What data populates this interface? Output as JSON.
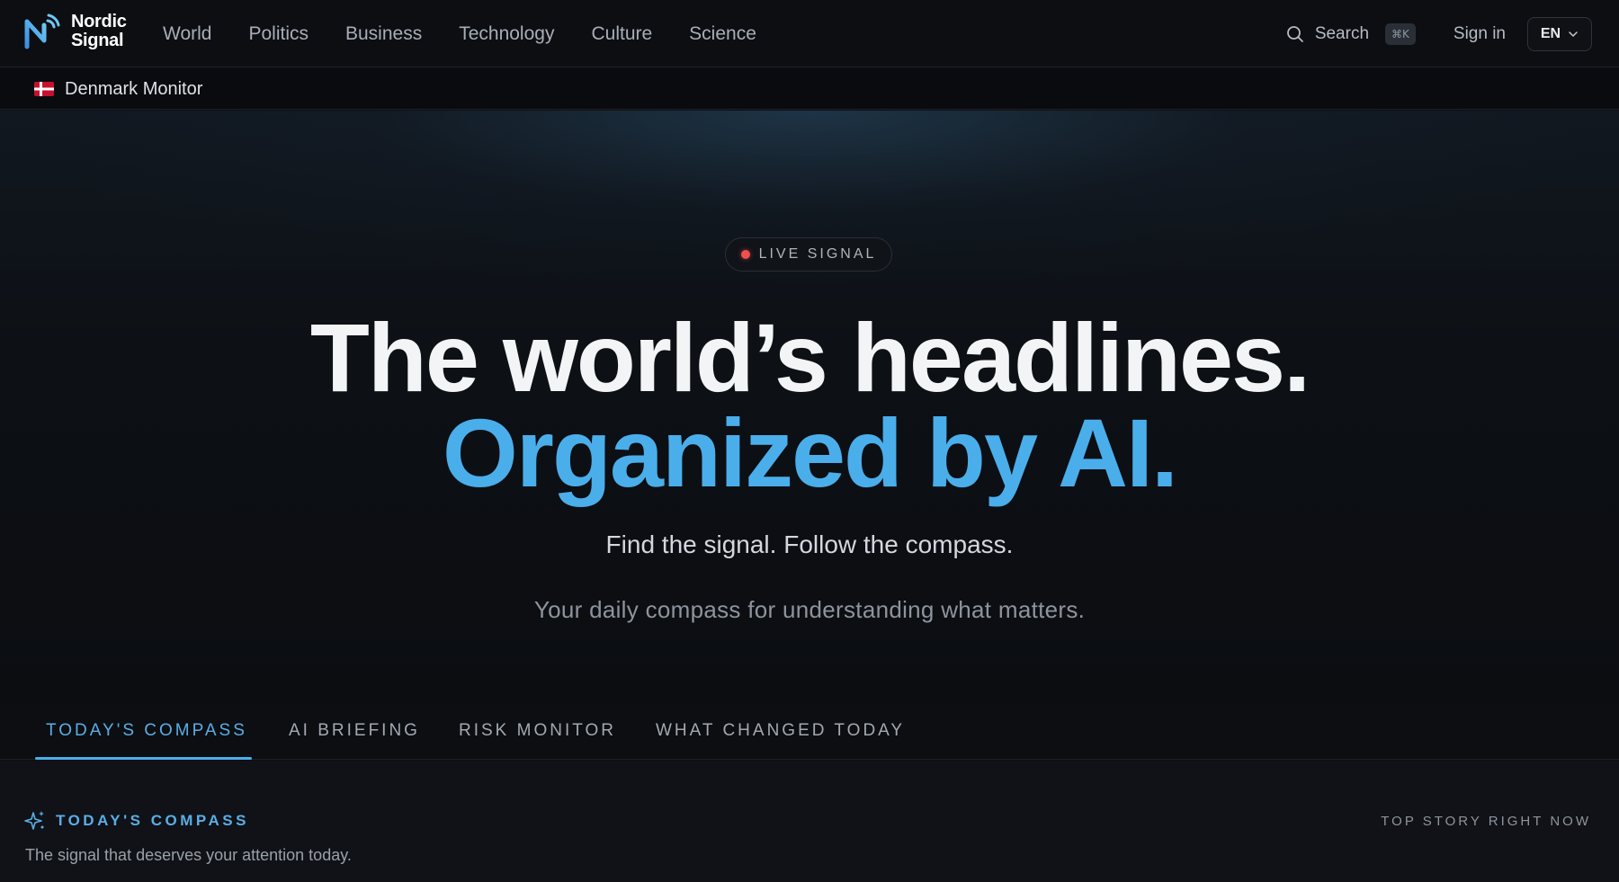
{
  "brand": {
    "line1": "Nordic",
    "line2": "Signal"
  },
  "nav": {
    "items": [
      {
        "label": "World"
      },
      {
        "label": "Politics"
      },
      {
        "label": "Business"
      },
      {
        "label": "Technology"
      },
      {
        "label": "Culture"
      },
      {
        "label": "Science"
      }
    ]
  },
  "header": {
    "search_label": "Search",
    "search_shortcut": "⌘K",
    "signin_label": "Sign in",
    "language": "EN"
  },
  "subbar": {
    "flag_icon": "denmark-flag-icon",
    "monitor_label": "Denmark Monitor"
  },
  "hero": {
    "badge": "LIVE SIGNAL",
    "headline": "The world’s headlines.",
    "headline_accent": "Organized by AI.",
    "tagline": "Find the signal. Follow the compass.",
    "subtagline": "Your daily compass for understanding what matters."
  },
  "tabs": [
    {
      "label": "TODAY'S COMPASS",
      "active": true
    },
    {
      "label": "AI BRIEFING",
      "active": false
    },
    {
      "label": "RISK MONITOR",
      "active": false
    },
    {
      "label": "WHAT CHANGED TODAY",
      "active": false
    }
  ],
  "compass": {
    "icon": "sparkle-icon",
    "title": "TODAY'S COMPASS",
    "description": "The signal that deserves your attention today.",
    "top_story_label": "TOP STORY RIGHT NOW"
  },
  "colors": {
    "accent": "#4aaeea",
    "live_dot": "#ef4f4f",
    "background": "#0c0e12"
  }
}
